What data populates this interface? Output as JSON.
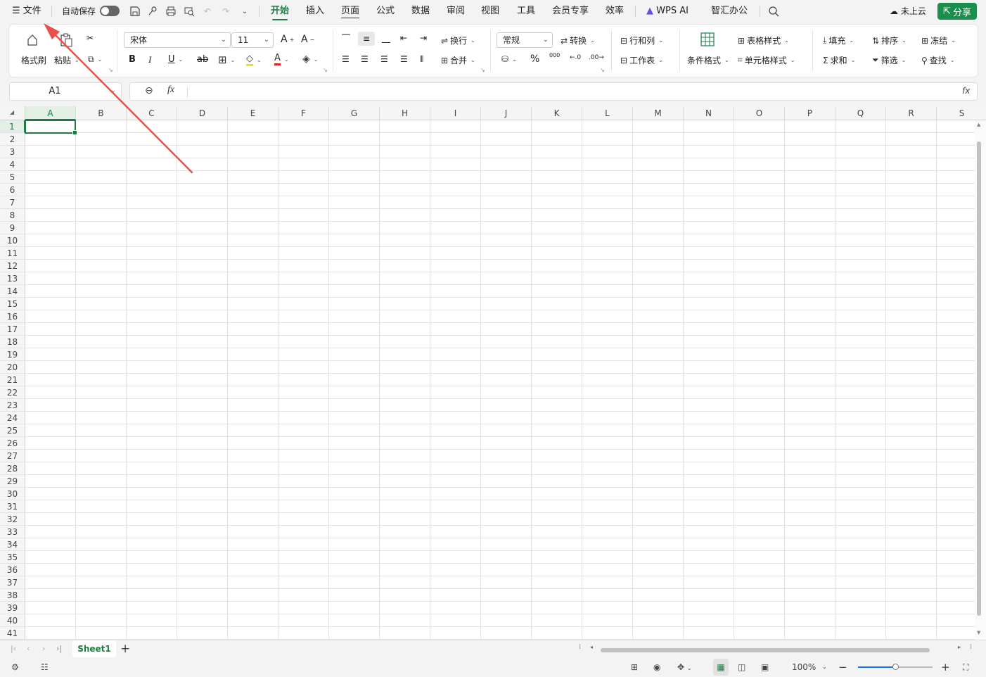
{
  "titlebar": {
    "file_menu": "文件",
    "autosave_label": "自动保存",
    "tabs": [
      "开始",
      "插入",
      "页面",
      "公式",
      "数据",
      "审阅",
      "视图",
      "工具",
      "会员专享",
      "效率"
    ],
    "wps_ai": "WPS AI",
    "smart_office": "智汇办公",
    "cloud_status": "未上云",
    "share": "分享"
  },
  "ribbon": {
    "format_painter": "格式刷",
    "paste": "粘贴",
    "font_name": "宋体",
    "font_size": "11",
    "bold": "B",
    "italic": "I",
    "underline": "U",
    "wrap": "换行",
    "merge": "合并",
    "number_format": "常规",
    "convert": "转换",
    "percent": "%",
    "thousands": "000",
    "rows_cols": "行和列",
    "worksheet": "工作表",
    "cond_format": "条件格式",
    "table_style": "表格样式",
    "cell_style": "单元格样式",
    "fill": "填充",
    "sort": "排序",
    "freeze": "冻结",
    "sum": "求和",
    "filter": "筛选",
    "find": "查找"
  },
  "formula": {
    "name_box": "A1",
    "fx": "fx",
    "value": ""
  },
  "grid": {
    "columns": [
      "A",
      "B",
      "C",
      "D",
      "E",
      "F",
      "G",
      "H",
      "I",
      "J",
      "K",
      "L",
      "M",
      "N",
      "O",
      "P",
      "Q",
      "R",
      "S"
    ],
    "rows": [
      "1",
      "2",
      "3",
      "4",
      "5",
      "6",
      "7",
      "8",
      "9",
      "10",
      "11",
      "12",
      "13",
      "14",
      "15",
      "16",
      "17",
      "18",
      "19",
      "20",
      "21",
      "22",
      "23",
      "24",
      "25",
      "26",
      "27",
      "28",
      "29",
      "30",
      "31",
      "32",
      "33",
      "34",
      "35",
      "36",
      "37",
      "38",
      "39",
      "40",
      "41"
    ],
    "selected_cell": "A1"
  },
  "sheets": [
    "Sheet1"
  ],
  "status": {
    "zoom": "100%",
    "zoom_fraction": 0.5
  },
  "colors": {
    "accent": "#1e7b45",
    "share_bg": "#1a8f4d",
    "arrow": "#e8504a"
  }
}
